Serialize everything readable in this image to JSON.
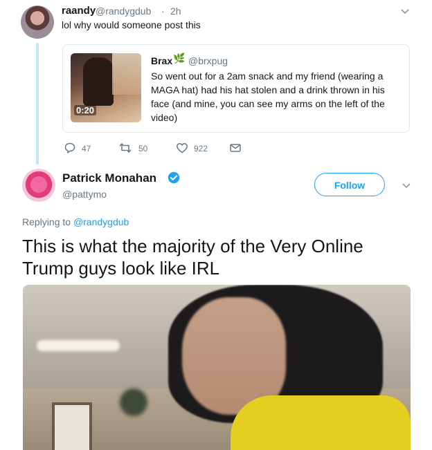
{
  "parent_tweet": {
    "name": "raandy",
    "handle": "@randygdub",
    "separator": "·",
    "time": "2h",
    "text": "lol why would someone post this",
    "quoted": {
      "name": "Brax",
      "emoji": "🌿",
      "handle": "@brxpug",
      "text": "So went out for a 2am snack and my friend (wearing a MAGA hat) had his hat stolen and a drink thrown in his face (and mine, you can see my arms on the left of the video)",
      "video_duration": "0:20"
    },
    "actions": {
      "reply_count": "47",
      "retweet_count": "50",
      "like_count": "922"
    }
  },
  "reply_tweet": {
    "name": "Patrick Monahan",
    "handle": "@pattymo",
    "follow_label": "Follow",
    "replying_prefix": "Replying to",
    "replying_handle": "@randygdub",
    "text": "This is what the majority of the Very Online Trump guys look like IRL"
  },
  "colors": {
    "accent": "#1da1f2",
    "muted": "#657786",
    "text": "#14171a",
    "thread_line": "#c4e4f7",
    "border": "#e1e8ed"
  }
}
